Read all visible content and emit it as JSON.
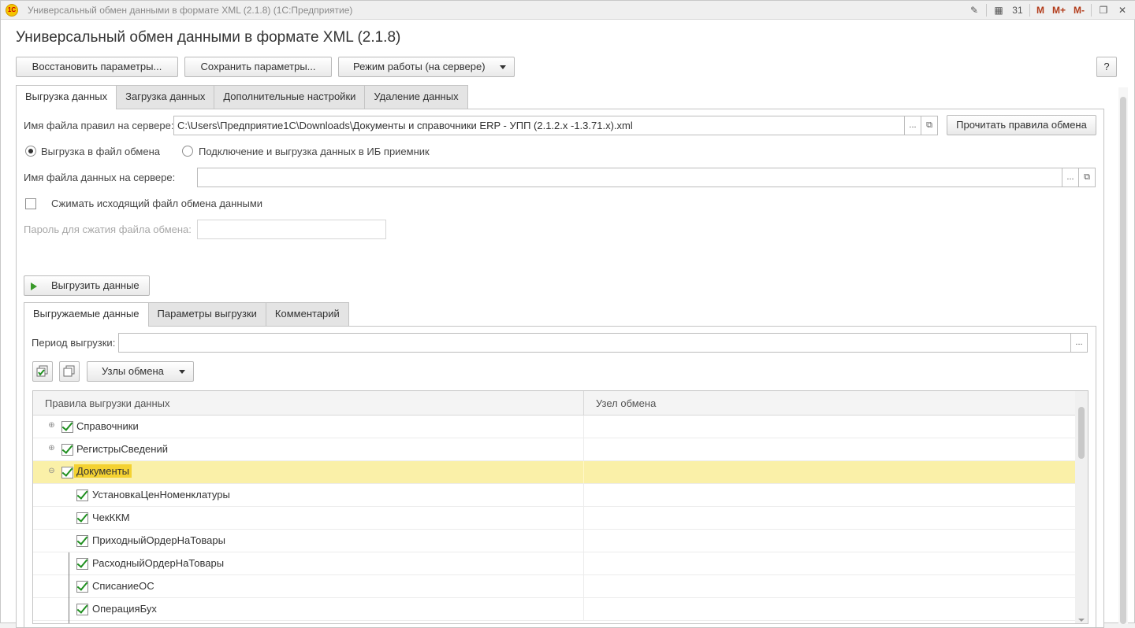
{
  "window": {
    "titlebar_text": "Универсальный обмен данными в формате XML (2.1.8)  (1С:Предприятие)",
    "logo_text": "1С",
    "titlebar_icons": [
      {
        "name": "notes-icon",
        "glyph": "✎"
      },
      {
        "name": "calculator-icon",
        "glyph": "▦"
      },
      {
        "name": "calendar-icon",
        "glyph": "31"
      },
      {
        "name": "memory-m-label",
        "glyph": "M"
      },
      {
        "name": "memory-plus-label",
        "glyph": "M+"
      },
      {
        "name": "memory-minus-label",
        "glyph": "M-"
      },
      {
        "name": "restore-window-icon",
        "glyph": "❐"
      },
      {
        "name": "close-window-icon",
        "glyph": "✕"
      }
    ]
  },
  "header": {
    "title": "Универсальный обмен данными в формате XML (2.1.8)",
    "buttons": {
      "restore": "Восстановить параметры...",
      "save": "Сохранить параметры...",
      "mode": "Режим работы (на сервере)",
      "help": "?"
    }
  },
  "main_tabs": [
    {
      "label": "Выгрузка данных",
      "active": true
    },
    {
      "label": "Загрузка данных",
      "active": false
    },
    {
      "label": "Дополнительные настройки",
      "active": false
    },
    {
      "label": "Удаление данных",
      "active": false
    }
  ],
  "export_form": {
    "rules_file_label": "Имя файла правил на сервере:",
    "rules_file_value": "C:\\Users\\Предприятие1С\\Downloads\\Документы и справочники ERP - УПП (2.1.2.x -1.3.71.x).xml",
    "read_rules_button": "Прочитать правила обмена",
    "radio_file": "Выгрузка в файл обмена",
    "radio_connect": "Подключение и выгрузка данных в ИБ приемник",
    "data_file_label": "Имя файла данных на сервере:",
    "data_file_value": "",
    "compress_label": "Сжимать исходящий файл обмена данными",
    "password_label": "Пароль для сжатия файла обмена:",
    "password_value": "",
    "export_button": "Выгрузить данные",
    "ellipsis": "...",
    "open_glyph": "⧉"
  },
  "sub_tabs": [
    {
      "label": "Выгружаемые данные",
      "active": true
    },
    {
      "label": "Параметры выгрузки",
      "active": false
    },
    {
      "label": "Комментарий",
      "active": false
    }
  ],
  "export_data": {
    "period_label": "Период выгрузки:",
    "period_value": "",
    "nodes_button": "Узлы обмена",
    "columns": [
      "Правила выгрузки данных",
      "Узел обмена"
    ],
    "rows": [
      {
        "label": "Справочники",
        "level": 0,
        "expander": "⊕",
        "selected": false
      },
      {
        "label": "РегистрыСведений",
        "level": 0,
        "expander": "⊕",
        "selected": false
      },
      {
        "label": "Документы",
        "level": 0,
        "expander": "⊖",
        "selected": true
      },
      {
        "label": "УстановкаЦенНоменклатуры",
        "level": 1,
        "expander": "",
        "selected": false
      },
      {
        "label": "ЧекККМ",
        "level": 1,
        "expander": "",
        "selected": false
      },
      {
        "label": "ПриходныйОрдерНаТовары",
        "level": 1,
        "expander": "",
        "selected": false
      },
      {
        "label": "РасходныйОрдерНаТовары",
        "level": 1,
        "expander": "",
        "selected": false
      },
      {
        "label": "СписаниеОС",
        "level": 1,
        "expander": "",
        "selected": false
      },
      {
        "label": "ОперацияБух",
        "level": 1,
        "expander": "",
        "selected": false
      }
    ]
  }
}
